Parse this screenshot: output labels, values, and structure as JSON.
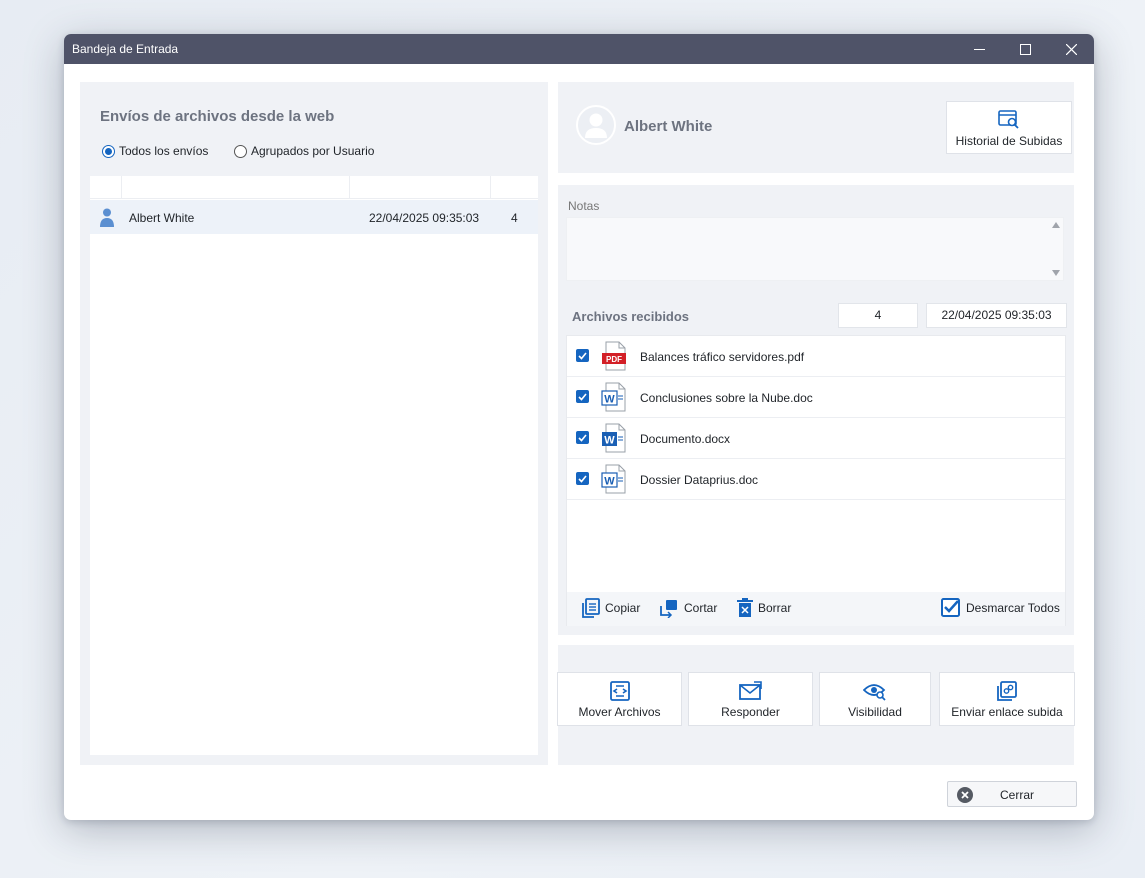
{
  "window": {
    "title": "Bandeja de Entrada"
  },
  "left": {
    "heading": "Envíos de archivos desde la web",
    "radios": [
      {
        "label": "Todos los envíos",
        "checked": true
      },
      {
        "label": "Agrupados por Usuario",
        "checked": false
      }
    ],
    "rows": [
      {
        "name": "Albert White",
        "date": "22/04/2025 09:35:03",
        "count": "4"
      }
    ]
  },
  "user": {
    "name": "Albert White",
    "history_button": "Historial de Subidas"
  },
  "notes": {
    "label": "Notas",
    "value": ""
  },
  "files": {
    "label": "Archivos recibidos",
    "count": "4",
    "date": "22/04/2025 09:35:03",
    "items": [
      {
        "name": "Balances tráfico servidores.pdf",
        "type": "pdf",
        "checked": true
      },
      {
        "name": "Conclusiones sobre la Nube.doc",
        "type": "doc",
        "checked": true
      },
      {
        "name": "Documento.docx",
        "type": "doc",
        "checked": true
      },
      {
        "name": "Dossier Dataprius.doc",
        "type": "doc",
        "checked": true
      }
    ],
    "toolbar": {
      "copy": "Copiar",
      "cut": "Cortar",
      "delete": "Borrar",
      "uncheck_all": "Desmarcar Todos"
    }
  },
  "actions": {
    "move": "Mover Archivos",
    "reply": "Responder",
    "visibility": "Visibilidad",
    "send_link": "Enviar enlace subida"
  },
  "close_button": "Cerrar",
  "colors": {
    "titlebar": "#4f5368",
    "accent": "#1565c0",
    "panel": "#f0f2f6"
  }
}
